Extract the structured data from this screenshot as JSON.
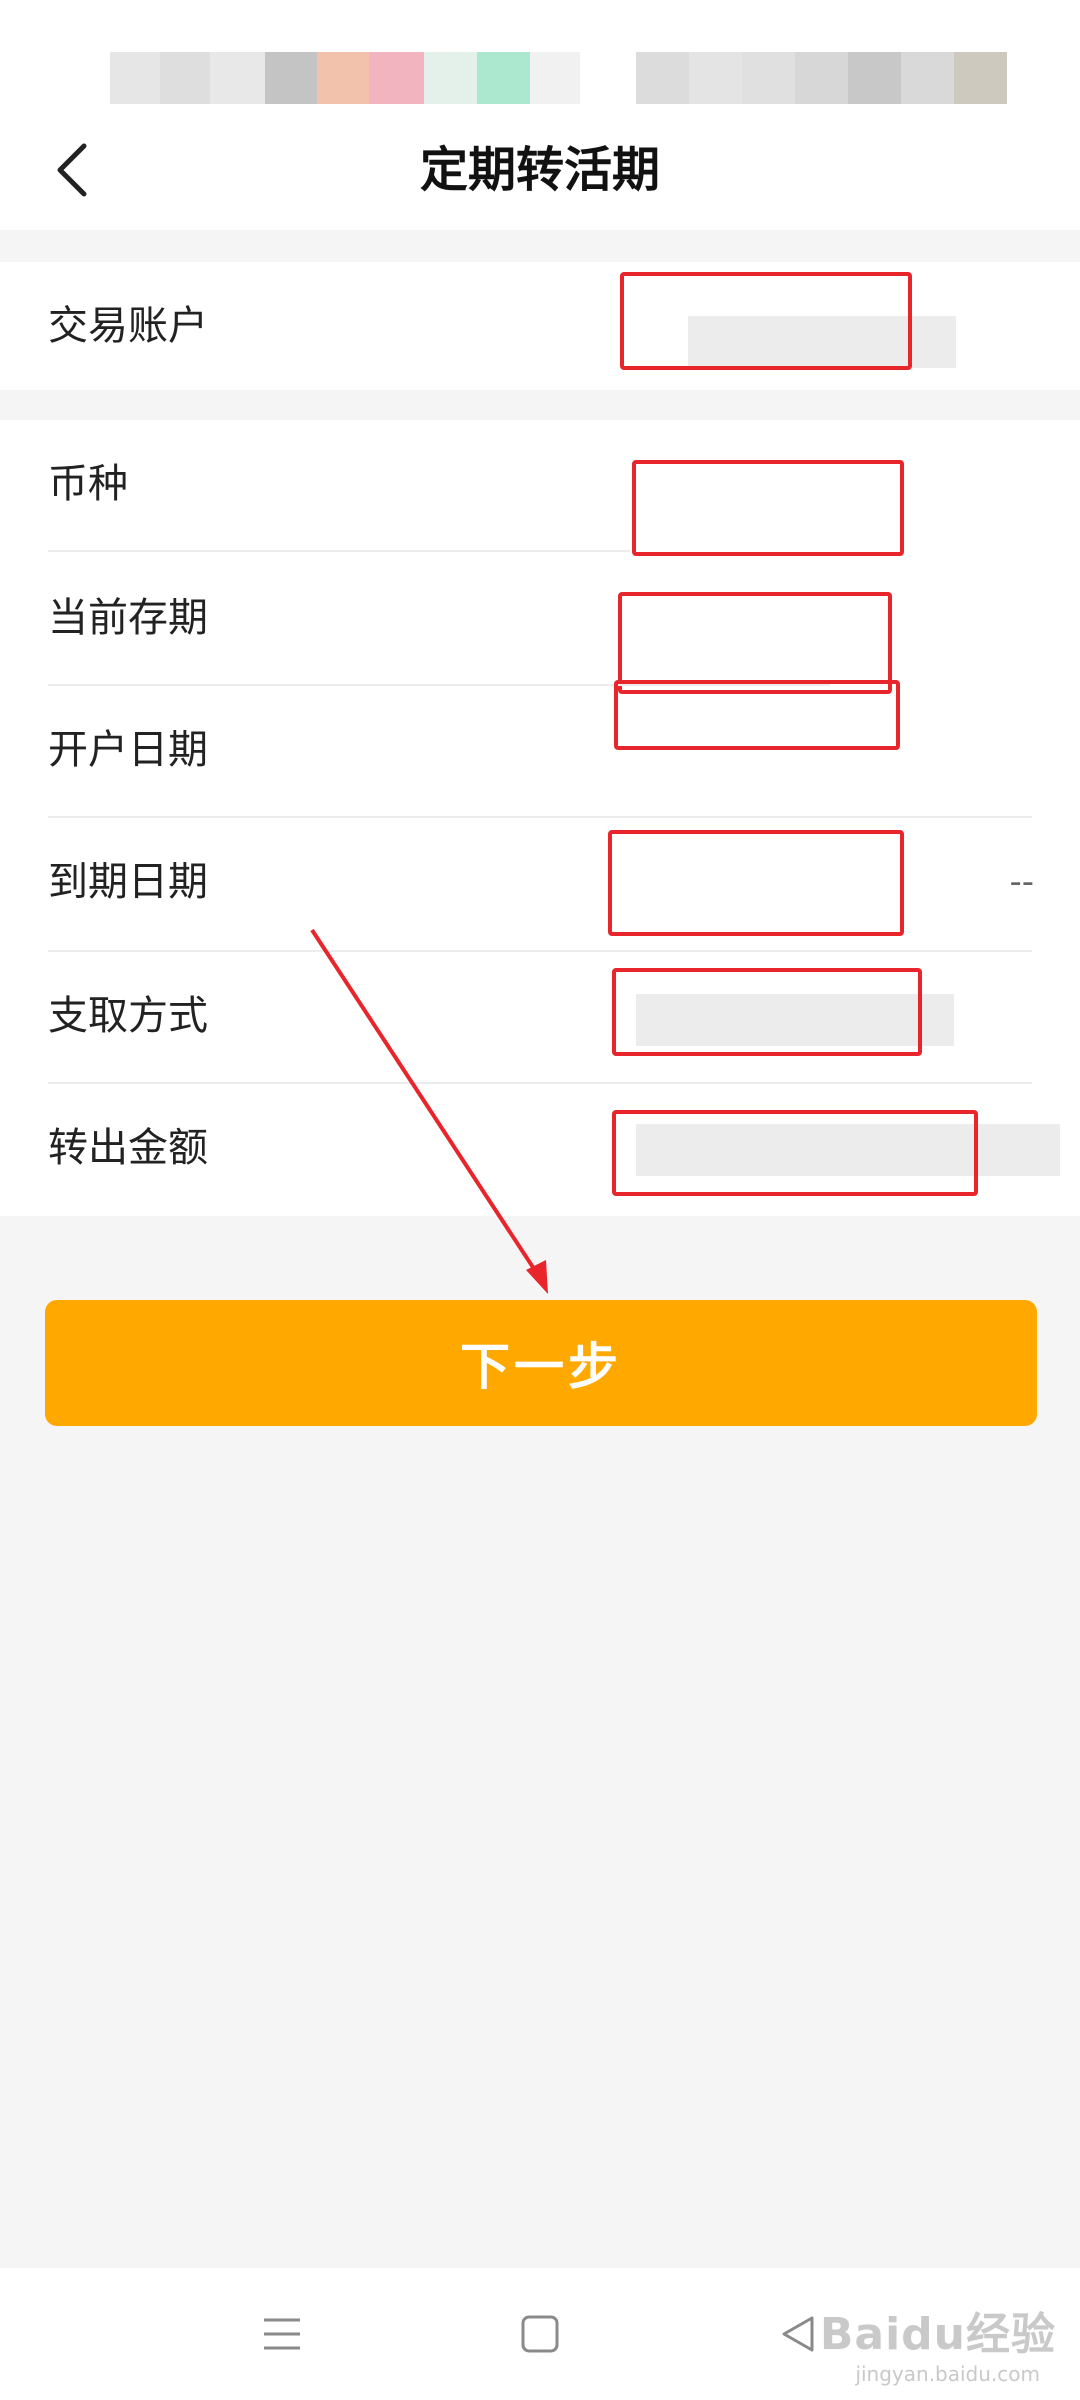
{
  "header": {
    "title": "定期转活期",
    "back_icon": "chevron-left-icon"
  },
  "account_section": {
    "label": "交易账户"
  },
  "detail_rows": [
    {
      "label": "币种"
    },
    {
      "label": "当前存期"
    },
    {
      "label": "开户日期"
    },
    {
      "label": "到期日期",
      "trailing": "--"
    },
    {
      "label": "支取方式"
    },
    {
      "label": "转出金额"
    }
  ],
  "primary_button": {
    "label": "下一步"
  },
  "annotation": {
    "box_color": "#e8252b",
    "arrow_color": "#e8252b"
  },
  "colors": {
    "accent": "#ffa800",
    "background": "#f5f5f5"
  },
  "system_nav": {
    "menu_icon": "menu-icon",
    "home_icon": "square-home-icon",
    "back_icon": "triangle-back-icon"
  },
  "watermark": {
    "main": "Baidu经验",
    "sub": "jingyan.baidu.com"
  }
}
